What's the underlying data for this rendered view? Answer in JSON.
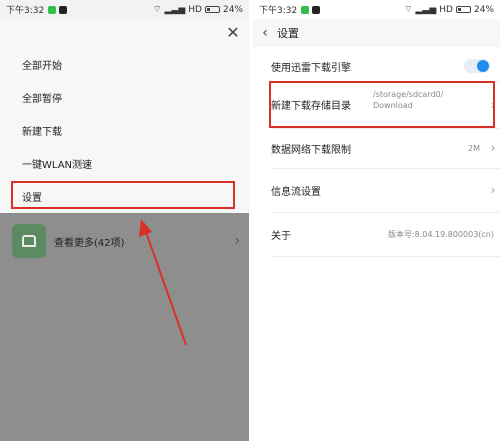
{
  "left": {
    "status": {
      "time": "下午3:32",
      "network": "HD",
      "battery": "24%"
    },
    "menu_items": [
      {
        "label": "全部开始"
      },
      {
        "label": "全部暂停"
      },
      {
        "label": "新建下载"
      },
      {
        "label": "一键WLAN测速"
      },
      {
        "label": "设置"
      }
    ],
    "more": {
      "label": "查看更多(42项)"
    }
  },
  "right": {
    "status": {
      "time": "下午3:32",
      "network": "HD",
      "battery": "24%"
    },
    "title": "设置",
    "rows": {
      "engine": {
        "label": "使用迅雷下载引擎",
        "toggle_on": true
      },
      "dir": {
        "label": "新建下载存储目录",
        "path_line1": "/storage/sdcard0/",
        "path_line2": "Download"
      },
      "limit": {
        "label": "数据网络下载限制",
        "value": "2M"
      },
      "feed": {
        "label": "信息流设置"
      },
      "about": {
        "label": "关于",
        "value": "版本号:8.04.19.800003(cn)"
      }
    }
  },
  "colors": {
    "highlight": "#d9302a",
    "toggle": "#1e8cf0",
    "overlay": "#8e8e8e"
  }
}
